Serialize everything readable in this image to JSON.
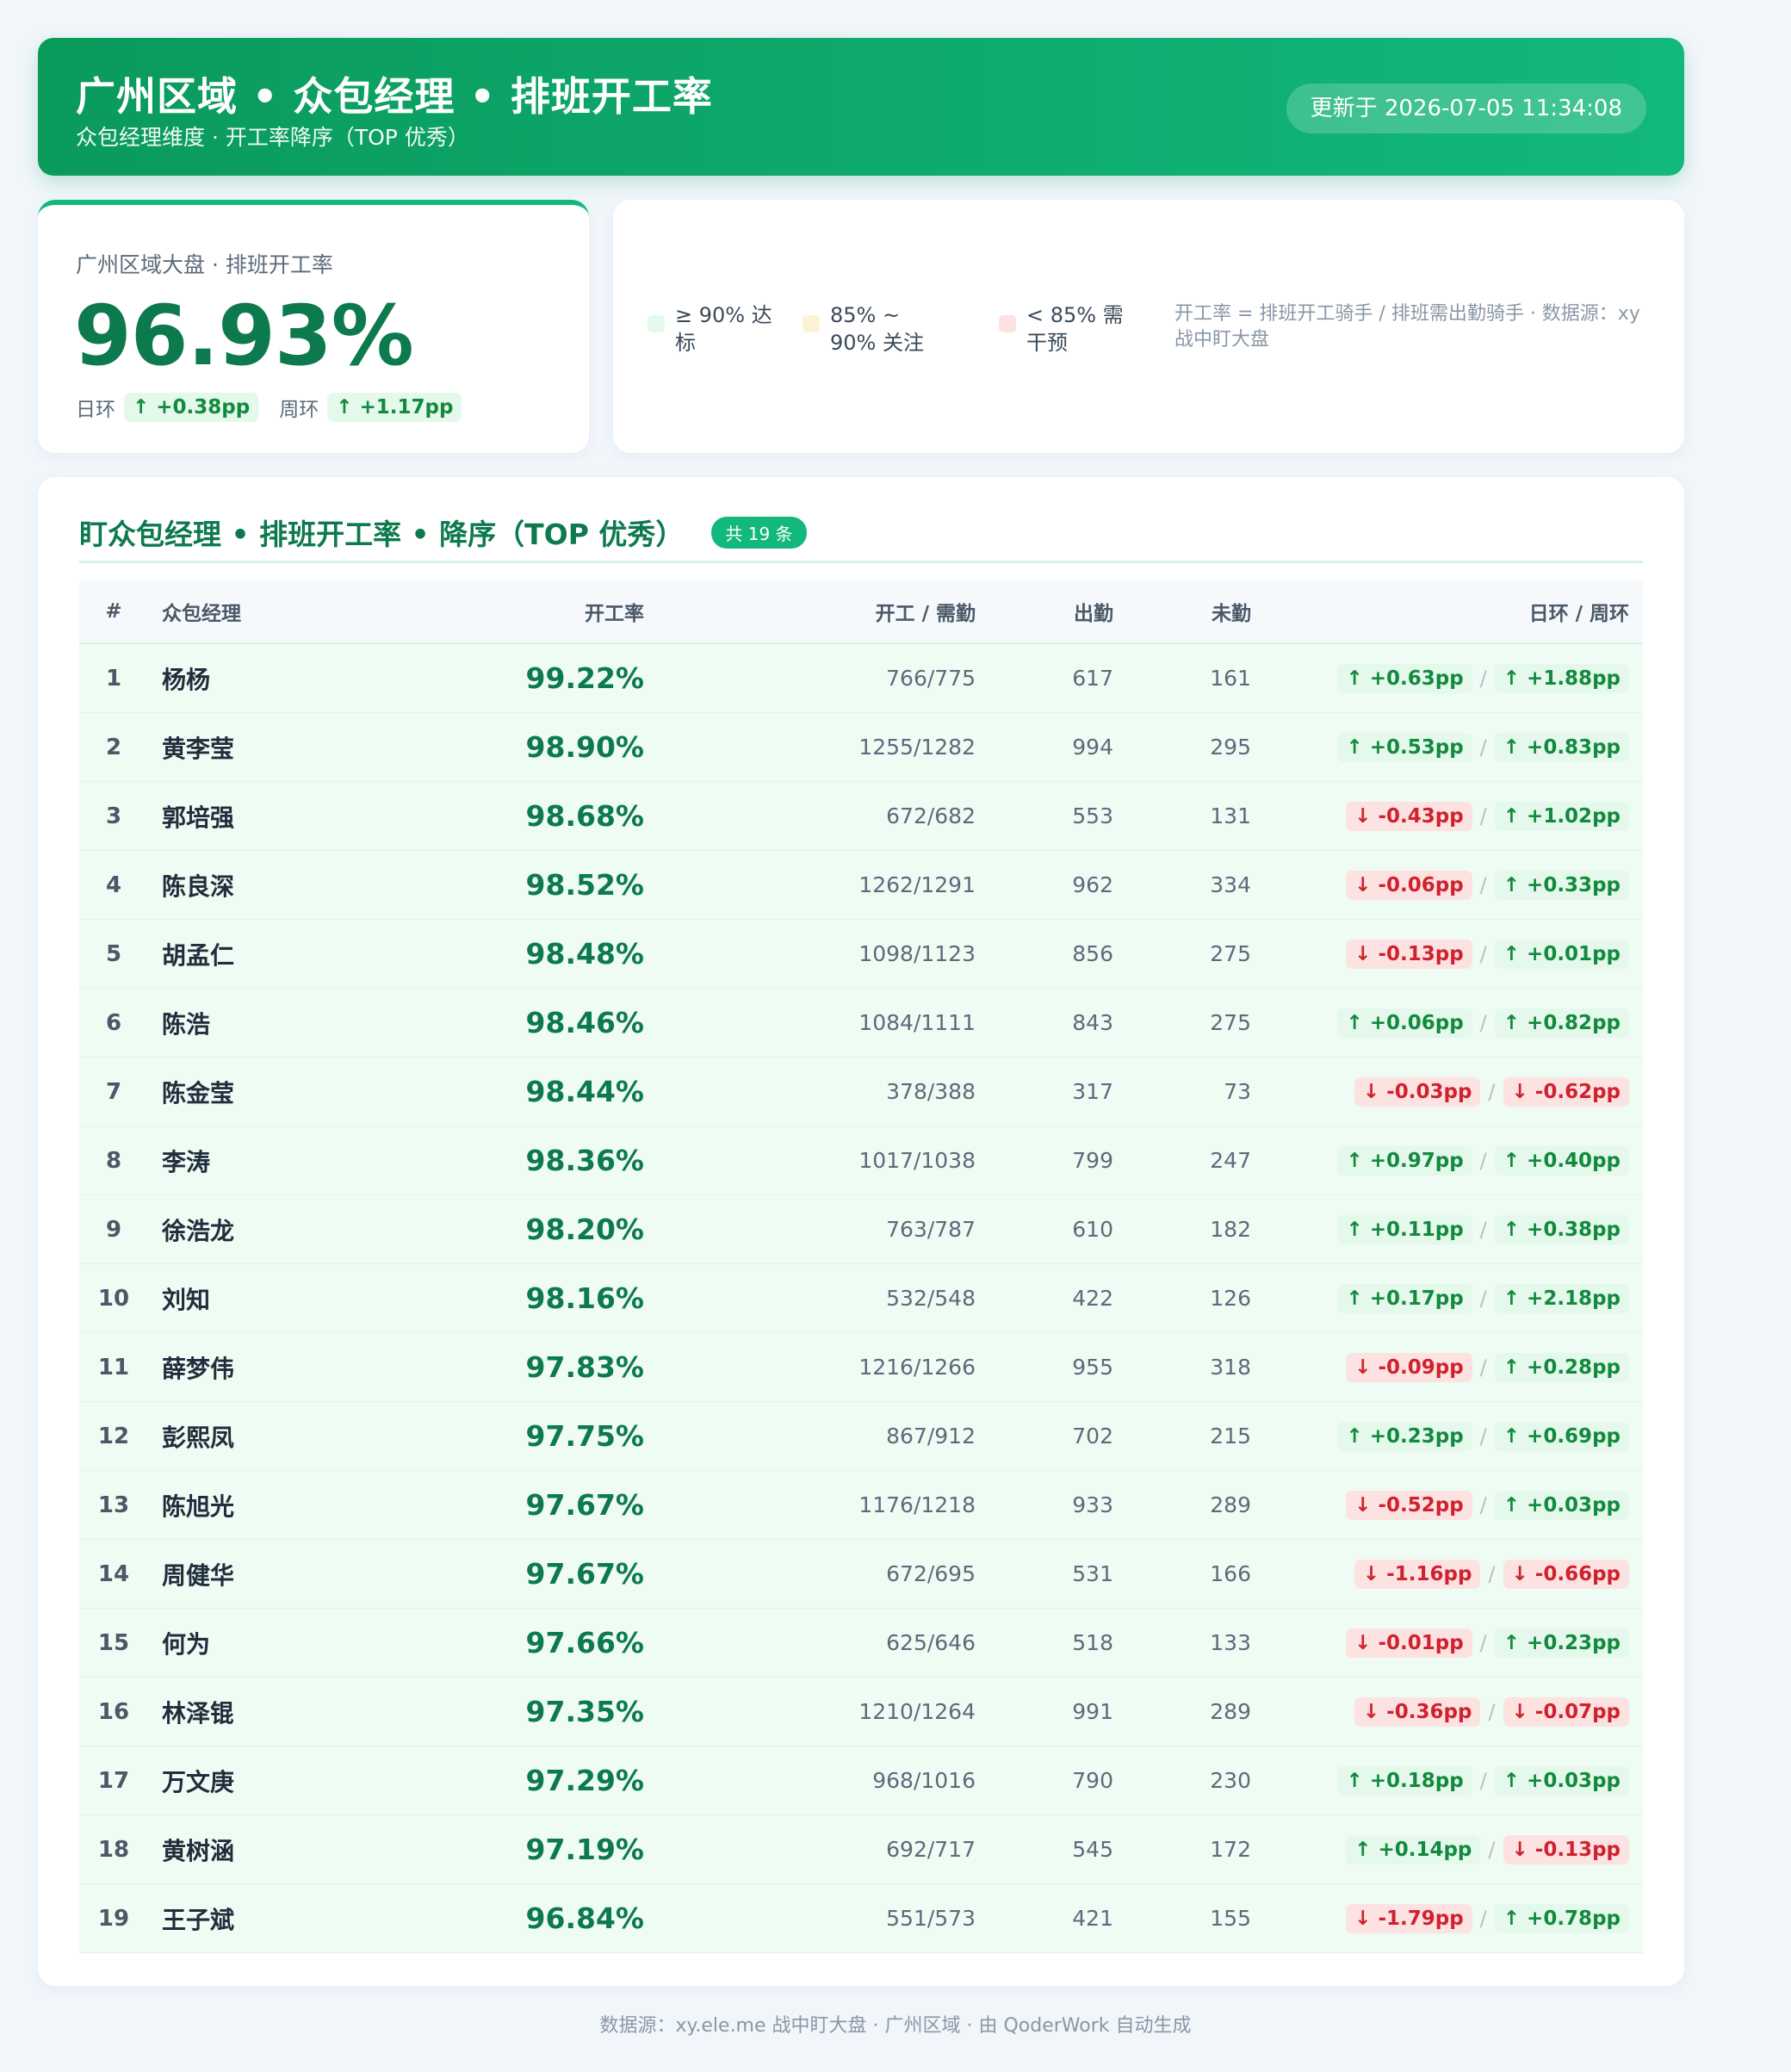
{
  "header": {
    "title": "广州区域 • 众包经理 • 排班开工率",
    "subtitle": "众包经理维度 · 开工率降序（TOP 优秀）",
    "updated": "更新于 2026-07-05 11:34:08"
  },
  "kpi": {
    "label": "广州区域大盘 · 排班开工率",
    "value": "96.93%",
    "day_label": "日环",
    "day_change": "↑ +0.38pp",
    "week_label": "周环",
    "week_change": "↑ +1.17pp"
  },
  "legend": {
    "items": [
      {
        "label": "≥ 90% 达标",
        "color": "#e4f8eb"
      },
      {
        "label": "85% ~ 90% 关注",
        "color": "#fdf3d2"
      },
      {
        "label": "< 85% 需干预",
        "color": "#fde2e2"
      }
    ],
    "note": "开工率 = 排班开工骑手 / 排班需出勤骑手 · 数据源：xy 战中盯大盘"
  },
  "table": {
    "title": "盯众包经理 • 排班开工率 • 降序（TOP 优秀）",
    "count": "共 19 条",
    "columns": {
      "idx": "#",
      "name": "众包经理",
      "rate": "开工率",
      "ratio": "开工 / 需勤",
      "attend": "出勤",
      "absent": "未勤",
      "change": "日环 / 周环"
    },
    "separator": "/",
    "rows": [
      {
        "idx": "1",
        "name": "杨杨",
        "rate": "99.22%",
        "ratio": "766/775",
        "attend": "617",
        "absent": "161",
        "day": "↑ +0.63pp",
        "day_dir": "up",
        "week": "↑ +1.88pp",
        "week_dir": "up"
      },
      {
        "idx": "2",
        "name": "黄李莹",
        "rate": "98.90%",
        "ratio": "1255/1282",
        "attend": "994",
        "absent": "295",
        "day": "↑ +0.53pp",
        "day_dir": "up",
        "week": "↑ +0.83pp",
        "week_dir": "up"
      },
      {
        "idx": "3",
        "name": "郭培强",
        "rate": "98.68%",
        "ratio": "672/682",
        "attend": "553",
        "absent": "131",
        "day": "↓ -0.43pp",
        "day_dir": "down",
        "week": "↑ +1.02pp",
        "week_dir": "up"
      },
      {
        "idx": "4",
        "name": "陈良深",
        "rate": "98.52%",
        "ratio": "1262/1291",
        "attend": "962",
        "absent": "334",
        "day": "↓ -0.06pp",
        "day_dir": "down",
        "week": "↑ +0.33pp",
        "week_dir": "up"
      },
      {
        "idx": "5",
        "name": "胡孟仁",
        "rate": "98.48%",
        "ratio": "1098/1123",
        "attend": "856",
        "absent": "275",
        "day": "↓ -0.13pp",
        "day_dir": "down",
        "week": "↑ +0.01pp",
        "week_dir": "up"
      },
      {
        "idx": "6",
        "name": "陈浩",
        "rate": "98.46%",
        "ratio": "1084/1111",
        "attend": "843",
        "absent": "275",
        "day": "↑ +0.06pp",
        "day_dir": "up",
        "week": "↑ +0.82pp",
        "week_dir": "up"
      },
      {
        "idx": "7",
        "name": "陈金莹",
        "rate": "98.44%",
        "ratio": "378/388",
        "attend": "317",
        "absent": "73",
        "day": "↓ -0.03pp",
        "day_dir": "down",
        "week": "↓ -0.62pp",
        "week_dir": "down"
      },
      {
        "idx": "8",
        "name": "李涛",
        "rate": "98.36%",
        "ratio": "1017/1038",
        "attend": "799",
        "absent": "247",
        "day": "↑ +0.97pp",
        "day_dir": "up",
        "week": "↑ +0.40pp",
        "week_dir": "up"
      },
      {
        "idx": "9",
        "name": "徐浩龙",
        "rate": "98.20%",
        "ratio": "763/787",
        "attend": "610",
        "absent": "182",
        "day": "↑ +0.11pp",
        "day_dir": "up",
        "week": "↑ +0.38pp",
        "week_dir": "up"
      },
      {
        "idx": "10",
        "name": "刘知",
        "rate": "98.16%",
        "ratio": "532/548",
        "attend": "422",
        "absent": "126",
        "day": "↑ +0.17pp",
        "day_dir": "up",
        "week": "↑ +2.18pp",
        "week_dir": "up"
      },
      {
        "idx": "11",
        "name": "薛梦伟",
        "rate": "97.83%",
        "ratio": "1216/1266",
        "attend": "955",
        "absent": "318",
        "day": "↓ -0.09pp",
        "day_dir": "down",
        "week": "↑ +0.28pp",
        "week_dir": "up"
      },
      {
        "idx": "12",
        "name": "彭熙凤",
        "rate": "97.75%",
        "ratio": "867/912",
        "attend": "702",
        "absent": "215",
        "day": "↑ +0.23pp",
        "day_dir": "up",
        "week": "↑ +0.69pp",
        "week_dir": "up"
      },
      {
        "idx": "13",
        "name": "陈旭光",
        "rate": "97.67%",
        "ratio": "1176/1218",
        "attend": "933",
        "absent": "289",
        "day": "↓ -0.52pp",
        "day_dir": "down",
        "week": "↑ +0.03pp",
        "week_dir": "up"
      },
      {
        "idx": "14",
        "name": "周健华",
        "rate": "97.67%",
        "ratio": "672/695",
        "attend": "531",
        "absent": "166",
        "day": "↓ -1.16pp",
        "day_dir": "down",
        "week": "↓ -0.66pp",
        "week_dir": "down"
      },
      {
        "idx": "15",
        "name": "何为",
        "rate": "97.66%",
        "ratio": "625/646",
        "attend": "518",
        "absent": "133",
        "day": "↓ -0.01pp",
        "day_dir": "down",
        "week": "↑ +0.23pp",
        "week_dir": "up"
      },
      {
        "idx": "16",
        "name": "林泽锟",
        "rate": "97.35%",
        "ratio": "1210/1264",
        "attend": "991",
        "absent": "289",
        "day": "↓ -0.36pp",
        "day_dir": "down",
        "week": "↓ -0.07pp",
        "week_dir": "down"
      },
      {
        "idx": "17",
        "name": "万文庚",
        "rate": "97.29%",
        "ratio": "968/1016",
        "attend": "790",
        "absent": "230",
        "day": "↑ +0.18pp",
        "day_dir": "up",
        "week": "↑ +0.03pp",
        "week_dir": "up"
      },
      {
        "idx": "18",
        "name": "黄树涵",
        "rate": "97.19%",
        "ratio": "692/717",
        "attend": "545",
        "absent": "172",
        "day": "↑ +0.14pp",
        "day_dir": "up",
        "week": "↓ -0.13pp",
        "week_dir": "down"
      },
      {
        "idx": "19",
        "name": "王子斌",
        "rate": "96.84%",
        "ratio": "551/573",
        "attend": "421",
        "absent": "155",
        "day": "↓ -1.79pp",
        "day_dir": "down",
        "week": "↑ +0.78pp",
        "week_dir": "up"
      }
    ]
  },
  "footer": "数据源：xy.ele.me 战中盯大盘 · 广州区域 · 由 QoderWork 自动生成"
}
